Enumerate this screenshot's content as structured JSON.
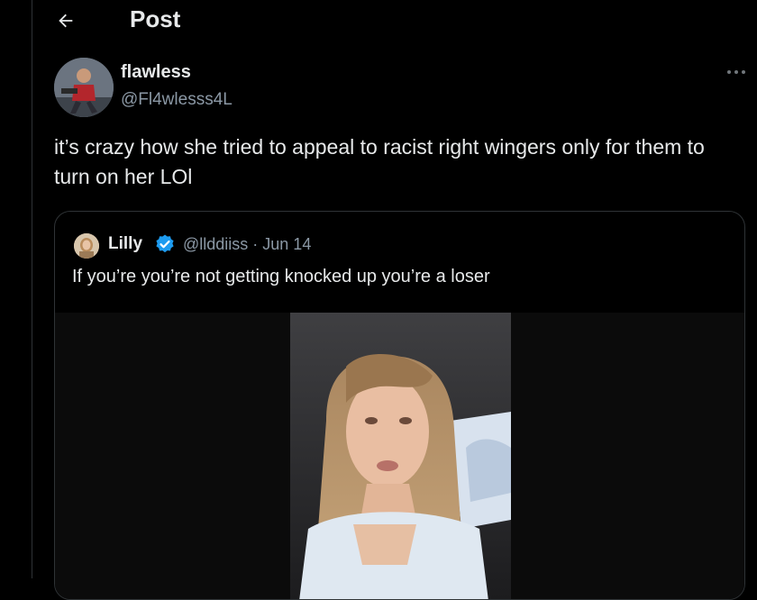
{
  "header": {
    "title": "Post"
  },
  "post": {
    "author": {
      "display_name": "flawless",
      "handle": "@Fl4wlesss4L"
    },
    "text": "it’s crazy how she tried to appeal to racist right wingers only for them to turn on her LOl"
  },
  "quoted": {
    "author": {
      "display_name": "Lilly",
      "handle": "@llddiiss",
      "date": "Jun 14"
    },
    "handle_date": "@llddiiss · Jun 14",
    "text": "If you’re you’re not getting knocked up you’re a loser"
  },
  "icons": {
    "back": "arrow-left-icon",
    "more": "more-horizontal-icon",
    "verified": "verified-badge-icon"
  },
  "colors": {
    "background": "#000000",
    "text": "#e7e9ea",
    "secondary": "#8b98a5",
    "border": "#2f3336",
    "verified": "#1d9bf0"
  }
}
